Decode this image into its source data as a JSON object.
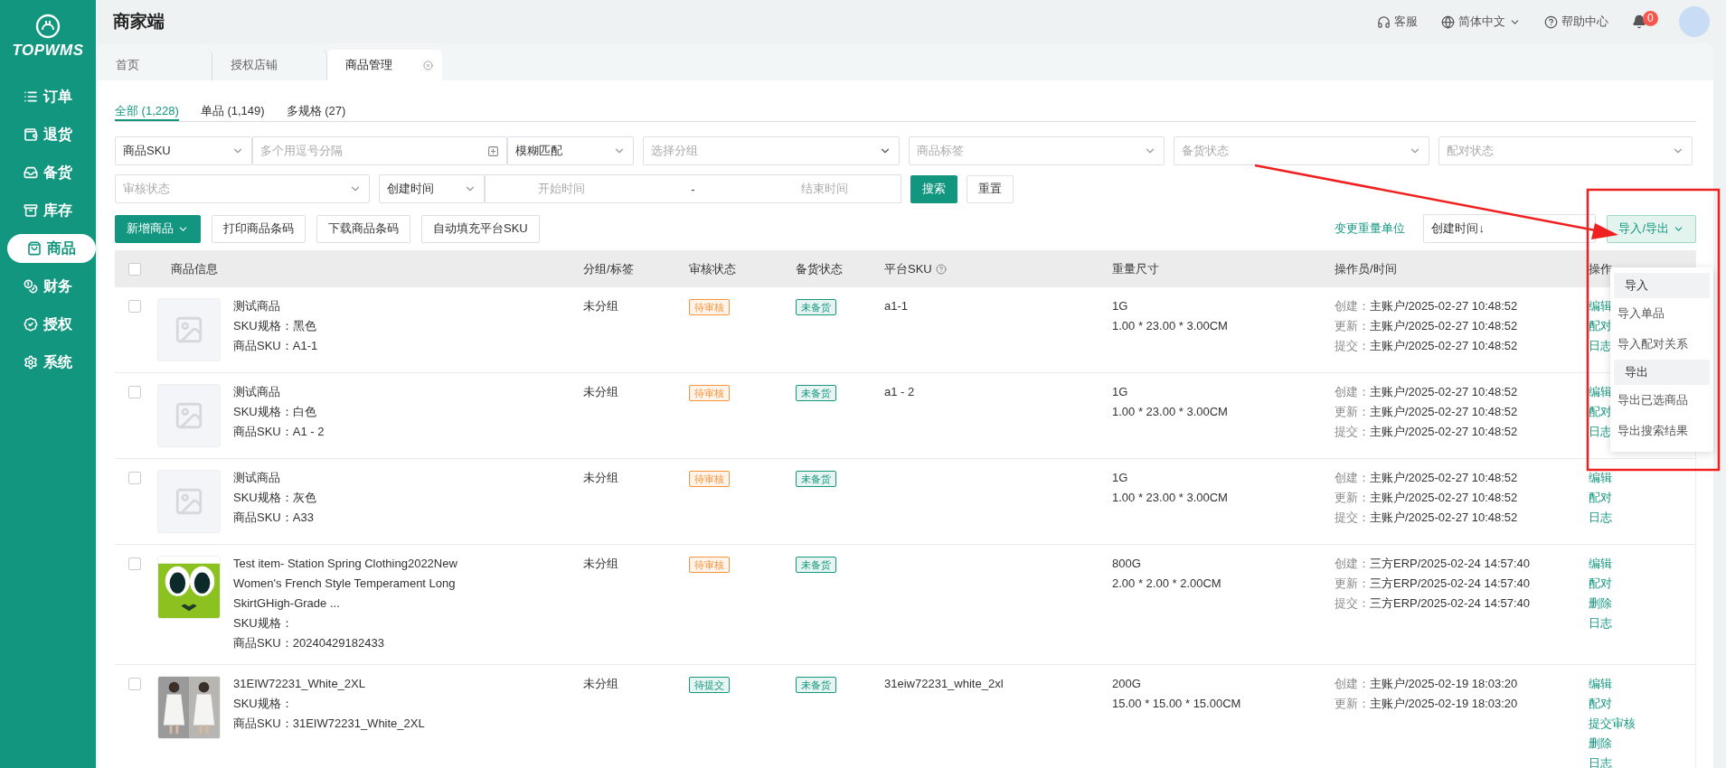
{
  "app": {
    "logo_text": "TOPWMS",
    "title": "商家端"
  },
  "nav": [
    {
      "label": "订单",
      "selected": false
    },
    {
      "label": "退货",
      "selected": false
    },
    {
      "label": "备货",
      "selected": false
    },
    {
      "label": "库存",
      "selected": false
    },
    {
      "label": "商品",
      "selected": true
    },
    {
      "label": "财务",
      "selected": false
    },
    {
      "label": "授权",
      "selected": false
    },
    {
      "label": "系统",
      "selected": false
    }
  ],
  "header": {
    "service": "客服",
    "language": "简体中文",
    "help": "帮助中心",
    "notifications": "0"
  },
  "page_tabs": [
    {
      "label": "首页",
      "selected": false
    },
    {
      "label": "授权店铺",
      "selected": false
    },
    {
      "label": "商品管理",
      "selected": true
    }
  ],
  "sub_tabs": [
    {
      "label": "全部 (1,228)",
      "selected": true
    },
    {
      "label": "单品 (1,149)",
      "selected": false
    },
    {
      "label": "多规格 (27)",
      "selected": false
    }
  ],
  "filters": {
    "sku_type": "商品SKU",
    "sku_input_placeholder": "多个用逗号分隔",
    "match_mode": "模糊匹配",
    "group_placeholder": "选择分组",
    "tag_placeholder": "商品标签",
    "stock_placeholder": "备货状态",
    "pair_placeholder": "配对状态",
    "audit_placeholder": "审核状态",
    "time_type": "创建时间",
    "start_placeholder": "开始时间",
    "range_separator": "-",
    "end_placeholder": "结束时间",
    "search": "搜索",
    "reset": "重置"
  },
  "actions": {
    "add": "新增商品",
    "print": "打印商品条码",
    "download": "下载商品条码",
    "autofill": "自动填充平台SKU",
    "weight_unit": "变更重量单位",
    "sort": "创建时间↓",
    "import_export": "导入/导出"
  },
  "table": {
    "select_all_checked": false,
    "columns": [
      "商品信息",
      "分组/标签",
      "审核状态",
      "备货状态",
      "平台SKU",
      "重量尺寸",
      "操作员/时间",
      "操作"
    ],
    "rows": [
      {
        "checked": false,
        "thumb": {
          "kind": "placeholder"
        },
        "title": "测试商品",
        "spec": "SKU规格：黑色",
        "sku": "商品SKU：A1-1",
        "group": "未分组",
        "audit": {
          "label": "待审核",
          "color": "#f7953a"
        },
        "stock": {
          "label": "未备货",
          "color": "#13987f"
        },
        "platform_sku": "a1-1",
        "weight": "1G",
        "size": "1.00 * 23.00 * 3.00CM",
        "log": [
          {
            "label": "创建：",
            "value": "主账户/2025-02-27 10:48:52"
          },
          {
            "label": "更新：",
            "value": "主账户/2025-02-27 10:48:52"
          },
          {
            "label": "提交：",
            "value": "主账户/2025-02-27 10:48:52"
          }
        ],
        "ops": [
          "编辑",
          "配对",
          "日志"
        ]
      },
      {
        "checked": false,
        "thumb": {
          "kind": "placeholder"
        },
        "title": "测试商品",
        "spec": "SKU规格：白色",
        "sku": "商品SKU：A1 - 2",
        "group": "未分组",
        "audit": {
          "label": "待审核",
          "color": "#f7953a"
        },
        "stock": {
          "label": "未备货",
          "color": "#13987f"
        },
        "platform_sku": "a1 - 2",
        "weight": "1G",
        "size": "1.00 * 23.00 * 3.00CM",
        "log": [
          {
            "label": "创建：",
            "value": "主账户/2025-02-27 10:48:52"
          },
          {
            "label": "更新：",
            "value": "主账户/2025-02-27 10:48:52"
          },
          {
            "label": "提交：",
            "value": "主账户/2025-02-27 10:48:52"
          }
        ],
        "ops": [
          "编辑",
          "配对",
          "日志"
        ]
      },
      {
        "checked": false,
        "thumb": {
          "kind": "placeholder"
        },
        "title": "测试商品",
        "spec": "SKU规格：灰色",
        "sku": "商品SKU：A33",
        "group": "未分组",
        "audit": {
          "label": "待审核",
          "color": "#f7953a"
        },
        "stock": {
          "label": "未备货",
          "color": "#13987f"
        },
        "weight": "1G",
        "size": "1.00 * 23.00 * 3.00CM",
        "log": [
          {
            "label": "创建：",
            "value": "主账户/2025-02-27 10:48:52"
          },
          {
            "label": "更新：",
            "value": "主账户/2025-02-27 10:48:52"
          },
          {
            "label": "提交：",
            "value": "主账户/2025-02-27 10:48:52"
          }
        ],
        "ops": [
          "编辑",
          "配对",
          "日志"
        ]
      },
      {
        "checked": false,
        "thumb": {
          "kind": "picture"
        },
        "title": "Test item- Station Spring Clothing2022New Women's French Style Temperament Long SkirtGHigh-Grade ...",
        "spec": "SKU规格：",
        "sku": "商品SKU：20240429182433",
        "group": "未分组",
        "audit": {
          "label": "待审核",
          "color": "#f7953a"
        },
        "stock": {
          "label": "未备货",
          "color": "#13987f"
        },
        "weight": "800G",
        "size": "2.00 * 2.00 * 2.00CM",
        "log": [
          {
            "label": "创建：",
            "value": "三方ERP/2025-02-24 14:57:40"
          },
          {
            "label": "更新：",
            "value": "三方ERP/2025-02-24 14:57:40"
          },
          {
            "label": "提交：",
            "value": "三方ERP/2025-02-24 14:57:40"
          }
        ],
        "ops": [
          "编辑",
          "配对",
          "删除",
          "日志"
        ]
      },
      {
        "checked": false,
        "thumb": {
          "kind": "picture"
        },
        "title": "31EIW72231_White_2XL",
        "spec": "SKU规格：",
        "sku": "商品SKU：31EIW72231_White_2XL",
        "group": "未分组",
        "audit": {
          "label": "待提交",
          "color": "#13987f"
        },
        "stock": {
          "label": "未备货",
          "color": "#13987f"
        },
        "platform_sku": "31eiw72231_white_2xl",
        "weight": "200G",
        "size": "15.00 * 15.00 * 15.00CM",
        "log": [
          {
            "label": "创建：",
            "value": "主账户/2025-02-19 18:03:20"
          },
          {
            "label": "更新：",
            "value": "主账户/2025-02-19 18:03:20"
          }
        ],
        "ops": [
          "编辑",
          "配对",
          "提交审核",
          "删除",
          "日志"
        ]
      }
    ]
  },
  "menu": [
    {
      "title": "导入",
      "items": [
        "导入单品",
        "导入配对关系"
      ]
    },
    {
      "title": "导出",
      "items": [
        "导出已选商品",
        "导出搜索结果"
      ]
    }
  ]
}
